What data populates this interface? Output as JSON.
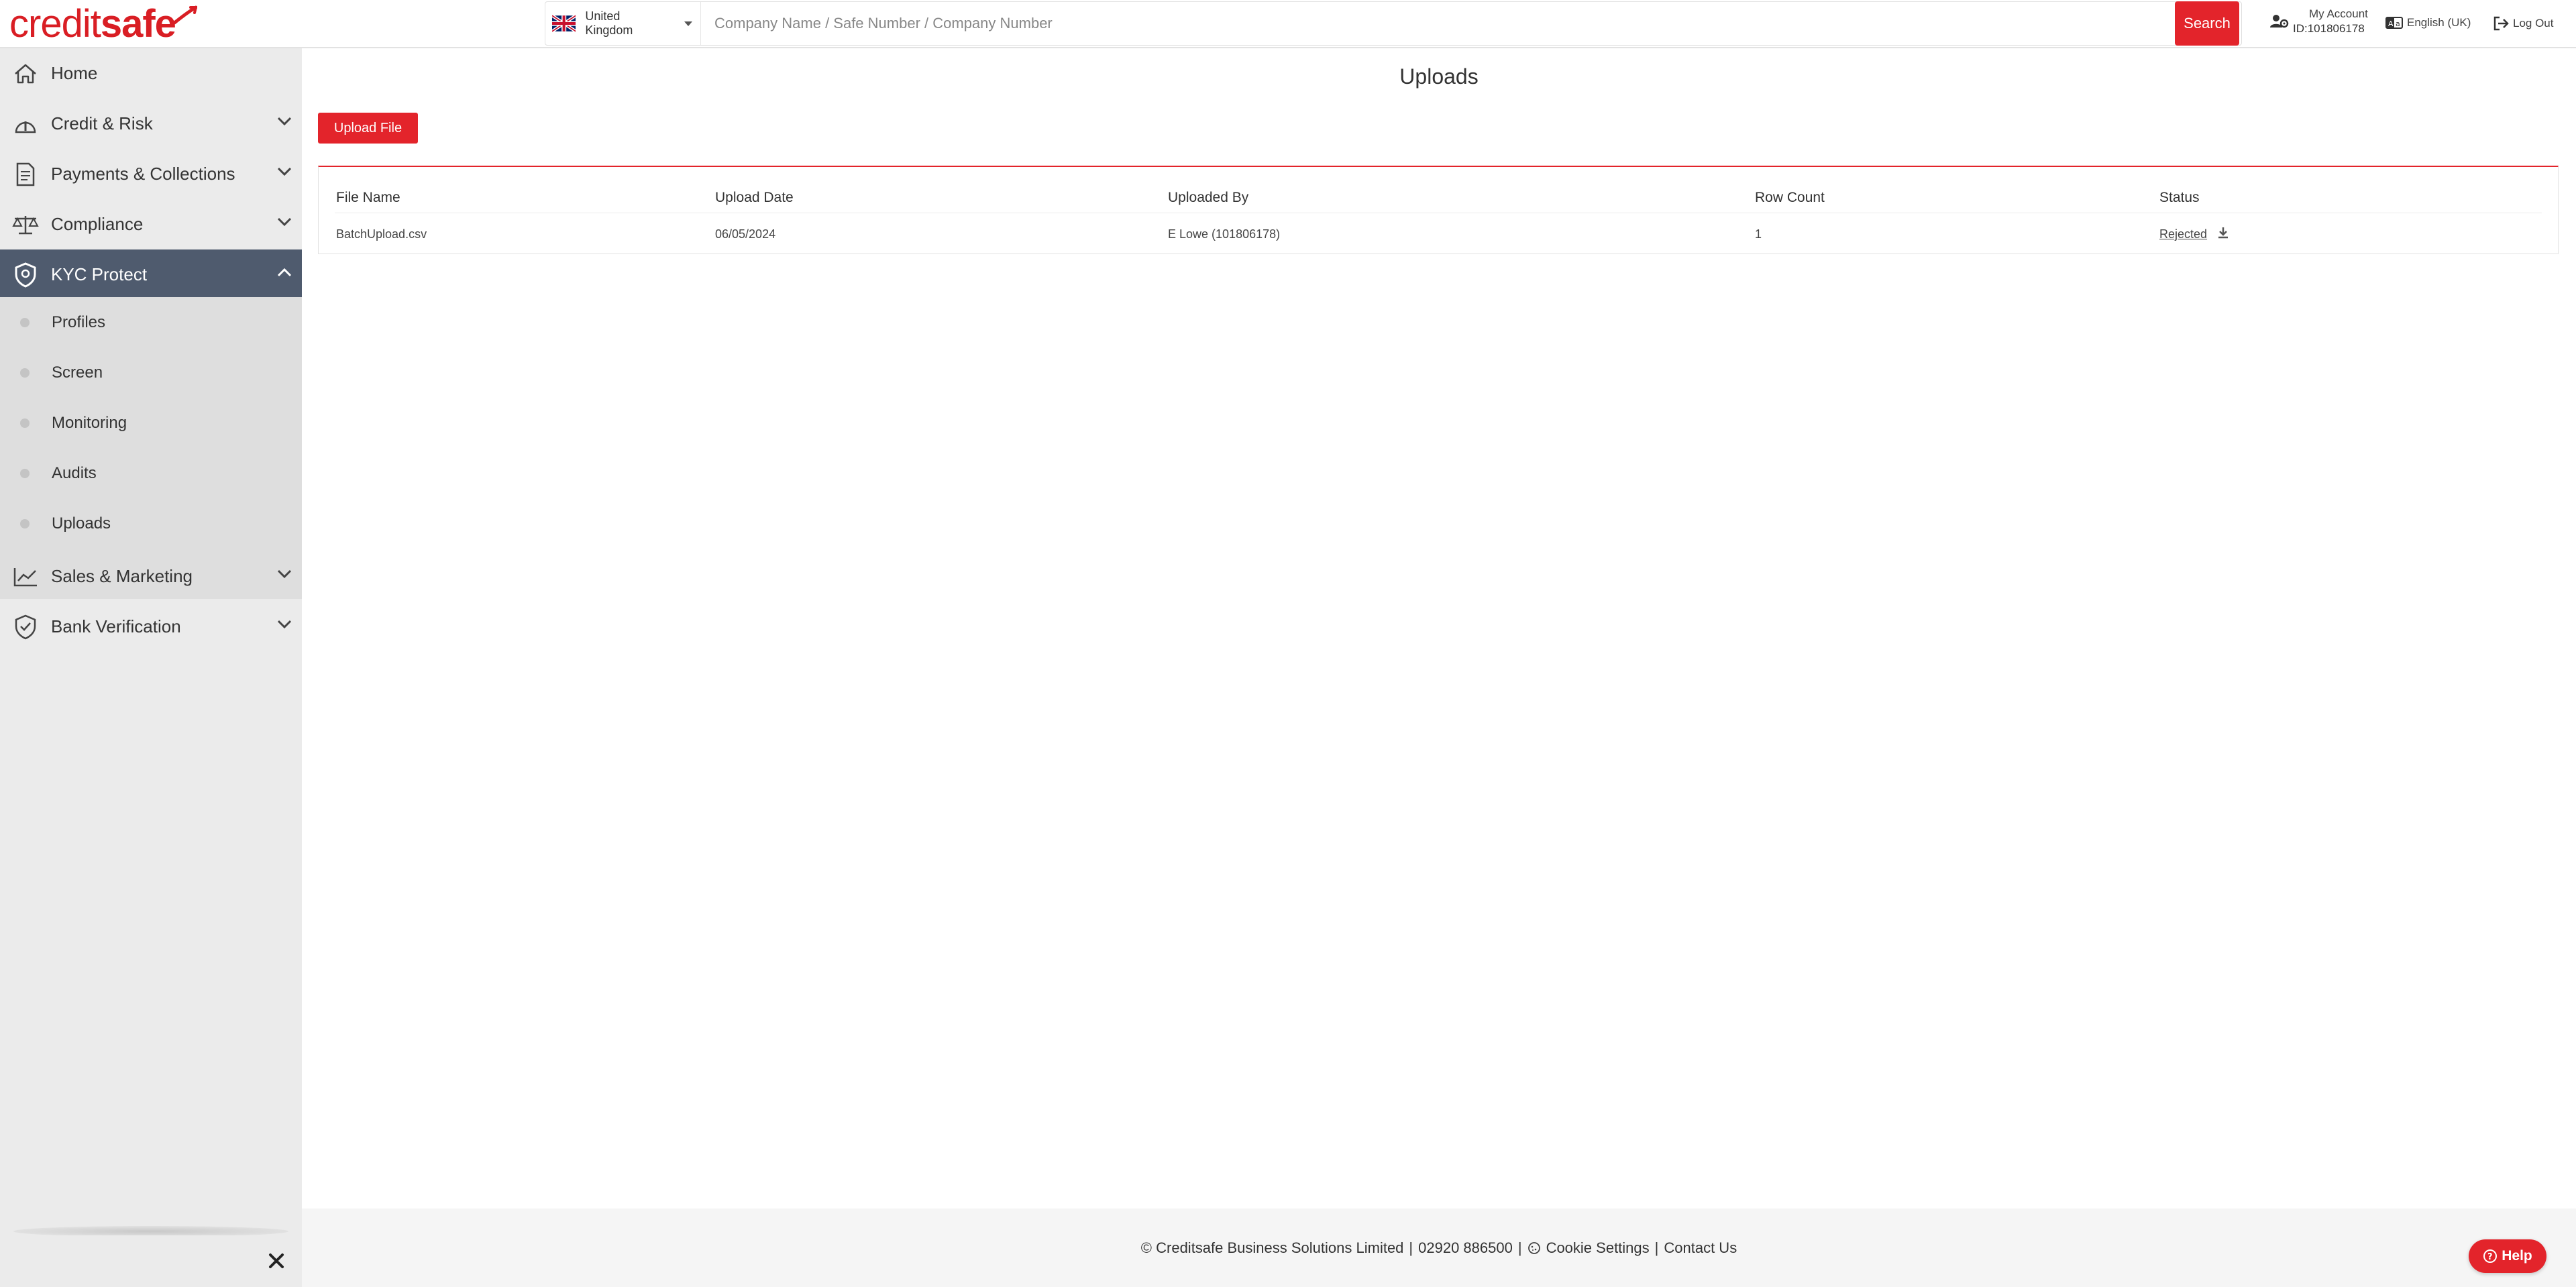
{
  "header": {
    "logo": {
      "part1": "credit",
      "part2": "safe"
    },
    "country": "United Kingdom",
    "search_placeholder": "Company Name / Safe Number / Company Number",
    "search_button": "Search",
    "account_label": "My Account",
    "account_id": "ID:101806178",
    "language": "English (UK)",
    "logout": "Log Out"
  },
  "sidebar": {
    "items": [
      {
        "label": "Home",
        "icon": "home-icon"
      },
      {
        "label": "Credit & Risk",
        "icon": "credit-risk-icon"
      },
      {
        "label": "Payments & Collections",
        "icon": "payments-icon"
      },
      {
        "label": "Compliance",
        "icon": "scales-icon"
      },
      {
        "label": "KYC Protect",
        "icon": "shield-icon"
      },
      {
        "label": "Sales & Marketing",
        "icon": "chart-icon"
      },
      {
        "label": "Bank Verification",
        "icon": "shield-check-icon"
      }
    ],
    "sub_items": [
      "Profiles",
      "Screen",
      "Monitoring",
      "Audits",
      "Uploads"
    ]
  },
  "main": {
    "title": "Uploads",
    "upload_button": "Upload File",
    "table": {
      "headers": [
        "File Name",
        "Upload Date",
        "Uploaded By",
        "Row Count",
        "Status"
      ],
      "rows": [
        {
          "file_name": "BatchUpload.csv",
          "upload_date": "06/05/2024",
          "uploaded_by": "E Lowe (101806178)",
          "row_count": "1",
          "status": "Rejected"
        }
      ]
    }
  },
  "footer": {
    "copyright": "© Creditsafe Business Solutions Limited",
    "phone": "02920 886500",
    "cookie": "Cookie Settings",
    "contact": "Contact Us",
    "separator": "|"
  },
  "help_button": "Help",
  "colors": {
    "brand_red": "#e3242b",
    "active_nav": "#4f5b6e",
    "sidebar_bg": "#ebebeb"
  }
}
